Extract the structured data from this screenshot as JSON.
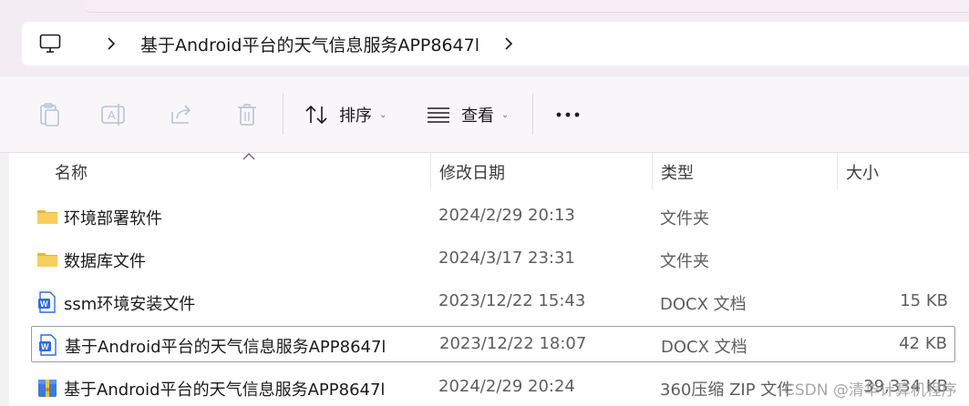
{
  "address": {
    "breadcrumb": "基于Android平台的天气信息服务APP8647l"
  },
  "toolbar": {
    "sort_label": "排序",
    "view_label": "查看"
  },
  "columns": {
    "name": "名称",
    "modified": "修改日期",
    "type": "类型",
    "size": "大小"
  },
  "files": [
    {
      "name": "环境部署软件",
      "modified": "2024/2/29 20:13",
      "type": "文件夹",
      "size": "",
      "icon": "folder-icon"
    },
    {
      "name": "数据库文件",
      "modified": "2024/3/17 23:31",
      "type": "文件夹",
      "size": "",
      "icon": "folder-icon"
    },
    {
      "name": "ssm环境安装文件",
      "modified": "2023/12/22 15:43",
      "type": "DOCX 文档",
      "size": "15 KB",
      "icon": "word-doc-icon"
    },
    {
      "name": "基于Android平台的天气信息服务APP8647l",
      "modified": "2023/12/22 18:07",
      "type": "DOCX 文档",
      "size": "42 KB",
      "icon": "word-doc-icon"
    },
    {
      "name": "基于Android平台的天气信息服务APP8647l",
      "modified": "2024/2/29 20:24",
      "type": "360压缩 ZIP 文件",
      "size": "39,334 KB",
      "icon": "zip-archive-icon"
    }
  ],
  "watermark": "CSDN @清华计算机程序",
  "colors": {
    "folder": "#f4c54a",
    "word": "#2b6ce8",
    "zip": "#3a7bd5"
  }
}
